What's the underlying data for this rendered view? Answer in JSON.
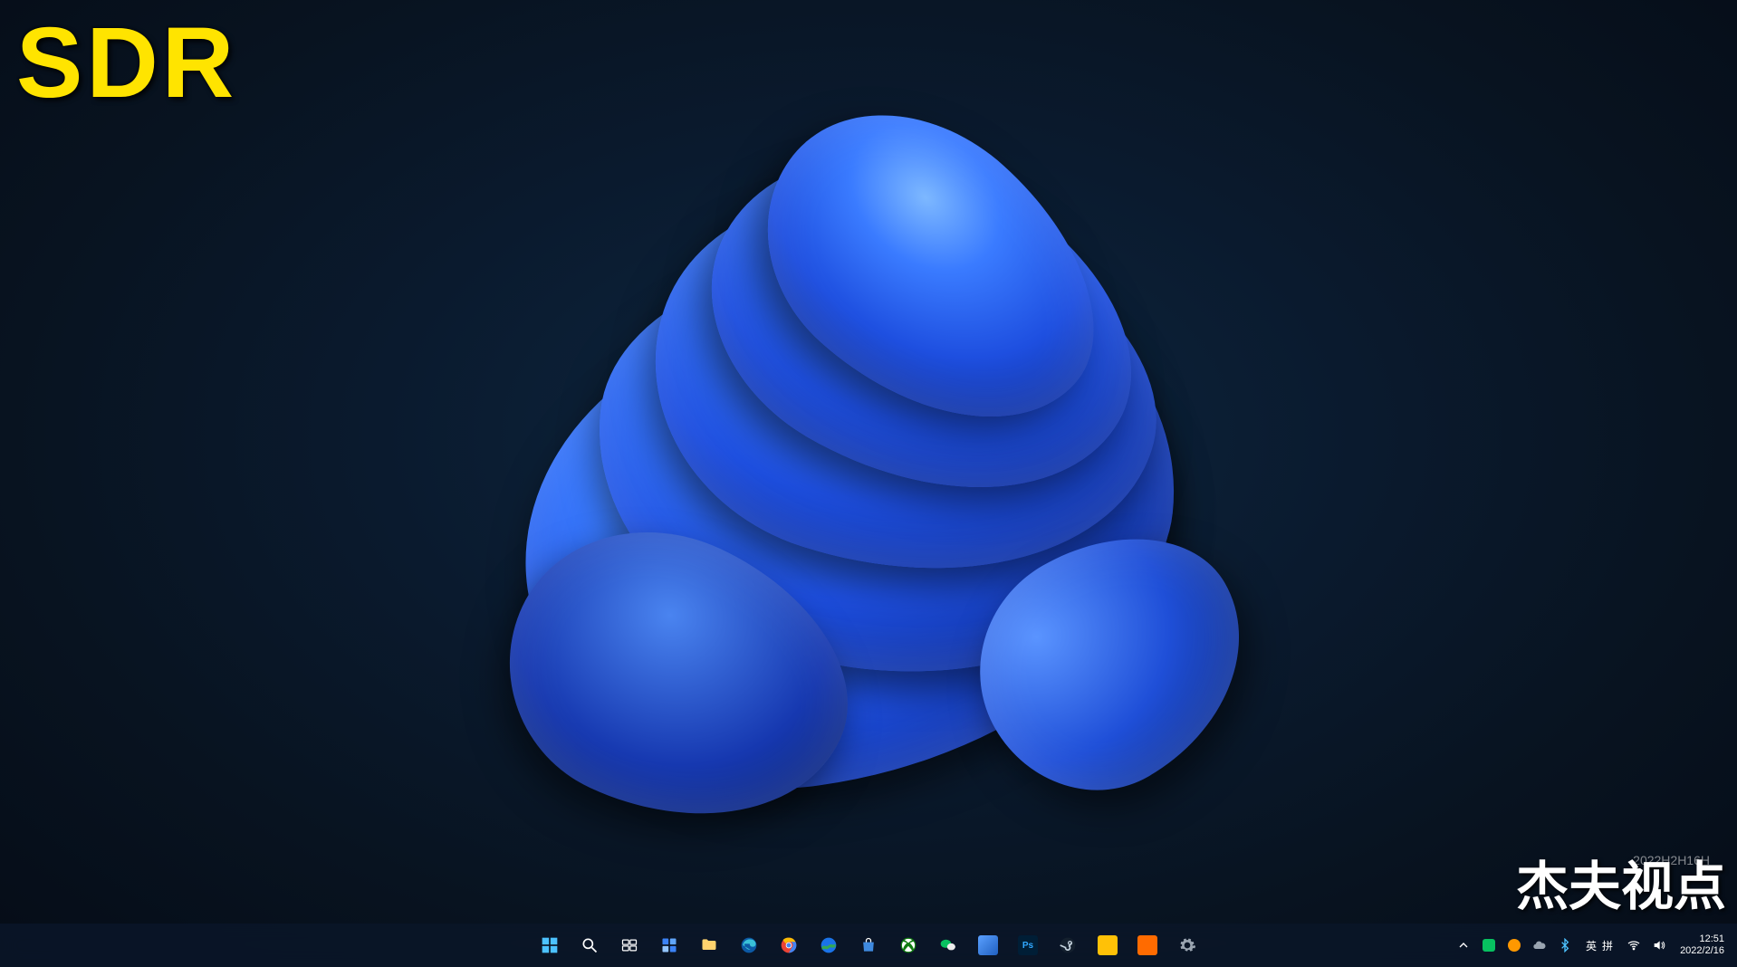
{
  "overlay": {
    "sdr_label": "SDR",
    "watermark": "杰夫视点",
    "watermark_sub": "2022H2H16H"
  },
  "taskbar": {
    "items": [
      {
        "name": "start-button",
        "icon": "windows"
      },
      {
        "name": "search-button",
        "icon": "search"
      },
      {
        "name": "task-view-button",
        "icon": "taskview"
      },
      {
        "name": "widgets-button",
        "icon": "widgets"
      },
      {
        "name": "file-explorer-button",
        "icon": "folder"
      },
      {
        "name": "edge-button",
        "icon": "edge"
      },
      {
        "name": "chrome-button",
        "icon": "chrome"
      },
      {
        "name": "google-earth-button",
        "icon": "earth"
      },
      {
        "name": "store-button",
        "icon": "store"
      },
      {
        "name": "xbox-button",
        "icon": "xbox"
      },
      {
        "name": "wechat-button",
        "icon": "wechat"
      },
      {
        "name": "control-panel-button",
        "icon": "control"
      },
      {
        "name": "photoshop-button",
        "icon": "ps"
      },
      {
        "name": "steam-button",
        "icon": "steam"
      },
      {
        "name": "app-yellow-button",
        "icon": "yellow"
      },
      {
        "name": "app-orange-button",
        "icon": "orange"
      },
      {
        "name": "app-settings-button",
        "icon": "gear"
      }
    ]
  },
  "tray": {
    "items": [
      {
        "name": "tray-overflow",
        "icon": "chevron-up"
      },
      {
        "name": "tray-app-1",
        "icon": "dot-green"
      },
      {
        "name": "tray-app-2",
        "icon": "dot-orange"
      },
      {
        "name": "tray-onedrive",
        "icon": "cloud"
      },
      {
        "name": "tray-bluetooth",
        "icon": "bluetooth"
      }
    ],
    "ime_lang": "英",
    "ime_mode": "拼",
    "network_icon": "wifi",
    "sound_icon": "speaker",
    "time": "12:51",
    "date": "2022/2/16"
  }
}
